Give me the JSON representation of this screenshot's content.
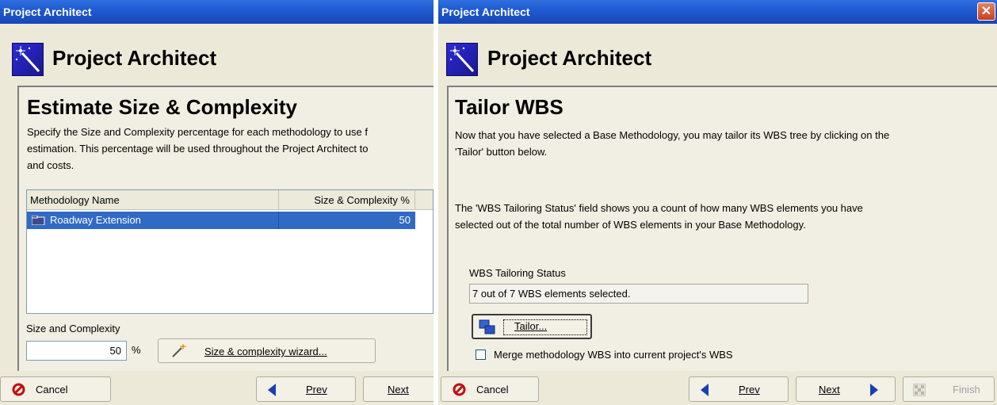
{
  "left": {
    "window_title": "Project Architect",
    "header_title": "Project Architect",
    "page_heading": "Estimate Size & Complexity",
    "description_lines": [
      "Specify the Size and Complexity percentage for each methodology to use f",
      "estimation.  This percentage will be used throughout the Project Architect to",
      "and costs."
    ],
    "table": {
      "columns": [
        "Methodology Name",
        "Size & Complexity %"
      ],
      "rows": [
        {
          "name": "Roadway Extension",
          "value": "50"
        }
      ]
    },
    "size_label": "Size and Complexity",
    "size_value": "50",
    "percent_sign": "%",
    "wizard_button": "Size & complexity wizard...",
    "cancel_button": "Cancel",
    "prev_button": "Prev",
    "next_button": "Next"
  },
  "right": {
    "window_title": "Project Architect",
    "header_title": "Project Architect",
    "page_heading": "Tailor WBS",
    "paragraph1_lines": [
      "Now that you have selected a Base Methodology, you may tailor its WBS tree by clicking on the",
      "'Tailor' button below."
    ],
    "paragraph2_lines": [
      "The 'WBS Tailoring Status' field shows you a count of how many WBS elements you have",
      "selected out of the total number of WBS elements in your Base Methodology."
    ],
    "status_label": "WBS Tailoring Status",
    "status_value": "7 out of 7 WBS elements selected.",
    "tailor_button": "Tailor...",
    "merge_checkbox_label": "Merge methodology WBS into current project's WBS",
    "merge_checked": false,
    "cancel_button": "Cancel",
    "prev_button": "Prev",
    "next_button": "Next",
    "finish_button": "Finish"
  },
  "colors": {
    "titlebar": "#1e58d0",
    "selection": "#316ac5",
    "dialog_bg": "#ece9d8",
    "cancel_icon": "#c01010",
    "arrow_icon": "#1a3fb5"
  }
}
